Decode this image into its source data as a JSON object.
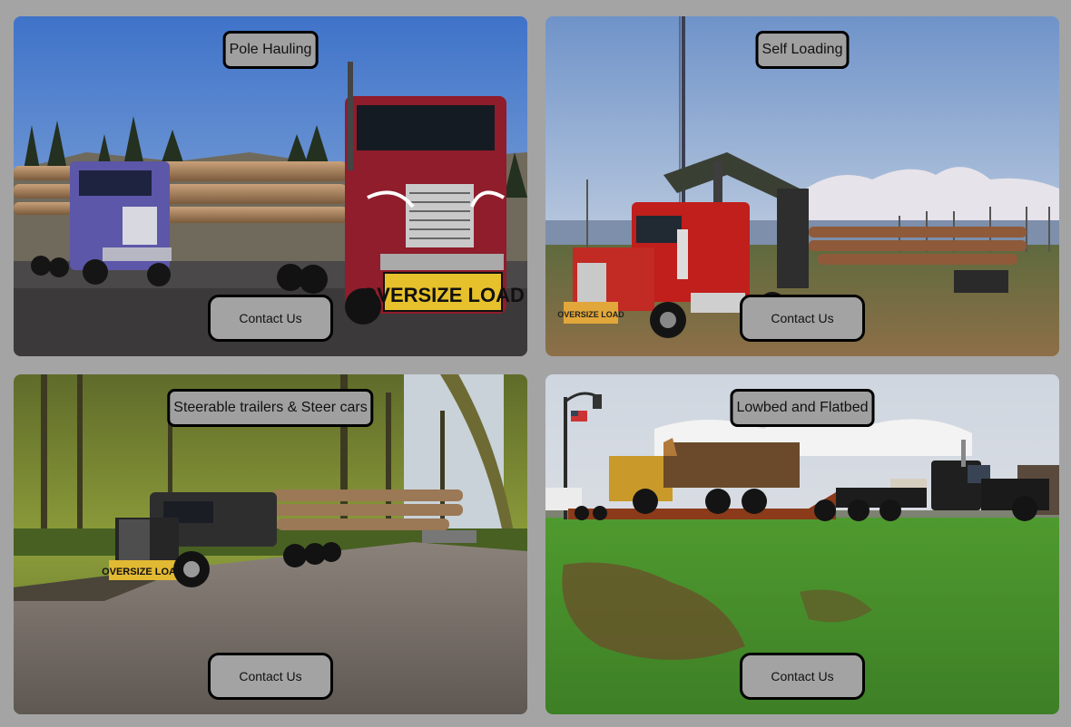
{
  "cards": [
    {
      "title": "Pole Hauling",
      "button": "Contact Us",
      "sign": "OVERSIZE LOAD"
    },
    {
      "title": "Self Loading",
      "button": "Contact Us",
      "sign": "OVERSIZE LOAD"
    },
    {
      "title": "Steerable trailers & Steer cars",
      "button": "Contact Us",
      "sign": "OVERSIZE LOAD"
    },
    {
      "title": "Lowbed and Flatbed",
      "button": "Contact Us"
    }
  ]
}
